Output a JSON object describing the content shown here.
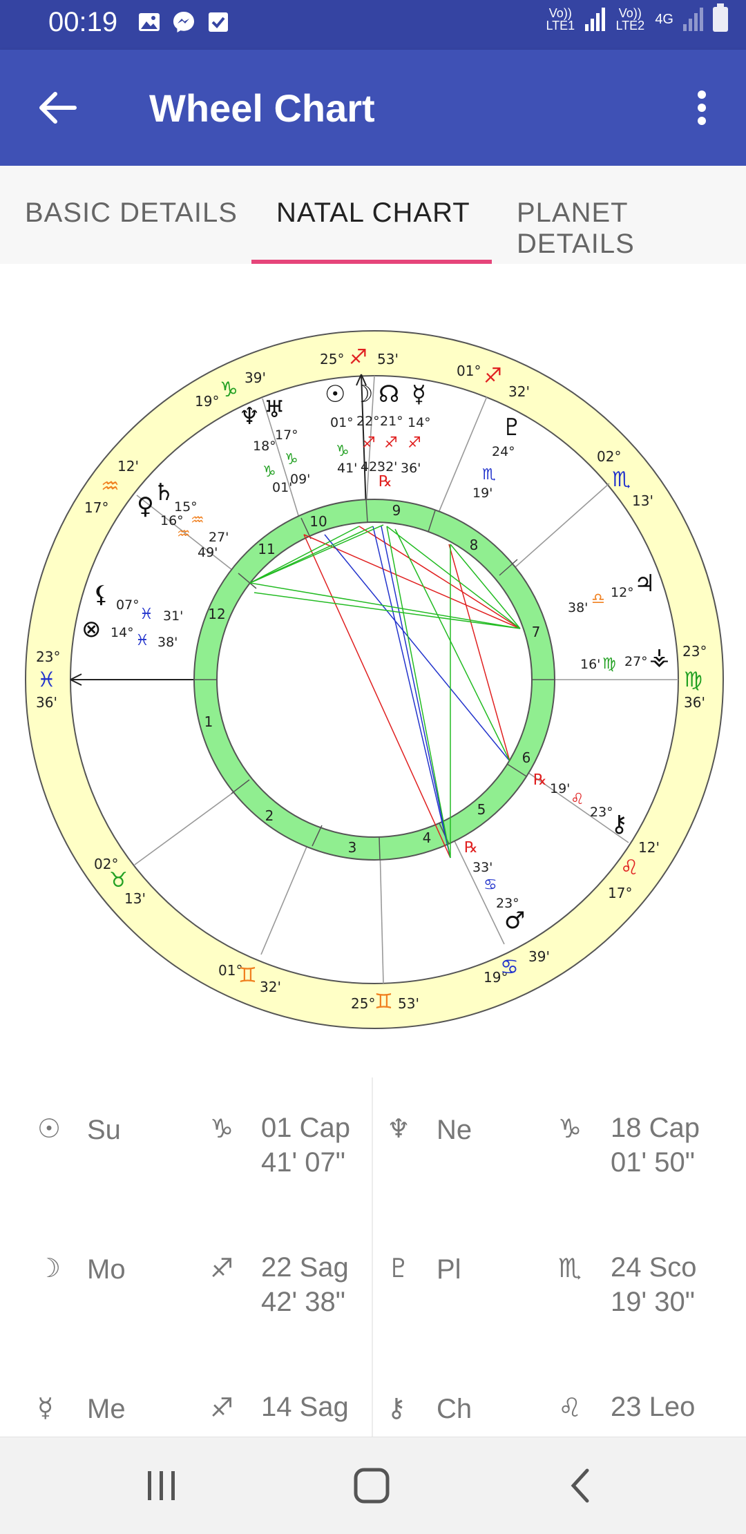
{
  "status_bar": {
    "time": "00:19",
    "network_1": "Vo)) LTE1",
    "network_2": "Vo)) LTE2",
    "network_3": "4G"
  },
  "app_bar": {
    "title": "Wheel Chart"
  },
  "tabs": [
    {
      "label": "BASIC DETAILS",
      "active": false
    },
    {
      "label": "NATAL CHART",
      "active": true
    },
    {
      "label": "PLANET DETAILS",
      "active": false
    }
  ],
  "wheel": {
    "cusp_labels": [
      {
        "deg": "25°",
        "min": "53'",
        "sign": "sagittarius"
      },
      {
        "deg": "01°",
        "min": "32'",
        "sign": "sagittarius"
      },
      {
        "deg": "02°",
        "min": "13'",
        "sign": "scorpio"
      },
      {
        "deg": "23°",
        "min": "36'",
        "sign": "virgo"
      },
      {
        "deg": "12'",
        "min": "17°",
        "sign": "leo"
      },
      {
        "deg": "39'",
        "min": "19°",
        "sign": "cancer"
      },
      {
        "deg": "25°",
        "min": "53'",
        "sign": "gemini"
      },
      {
        "deg": "01°",
        "min": "32'",
        "sign": "gemini"
      },
      {
        "deg": "02°",
        "min": "13'",
        "sign": "taurus"
      },
      {
        "deg": "23°",
        "min": "36'",
        "sign": "pisces"
      },
      {
        "deg": "12'",
        "min": "17°",
        "sign": "aquarius"
      },
      {
        "deg": "19°",
        "min": "39'",
        "sign": "capricorn"
      }
    ],
    "house_numbers": [
      "1",
      "2",
      "3",
      "4",
      "5",
      "6",
      "7",
      "8",
      "9",
      "10",
      "11",
      "12"
    ],
    "planet_labels": [
      {
        "text": "17°"
      },
      {
        "text": "18°"
      },
      {
        "text": "01'"
      },
      {
        "text": "09'"
      },
      {
        "text": "01°"
      },
      {
        "text": "22°"
      },
      {
        "text": "21°"
      },
      {
        "text": "14°"
      },
      {
        "text": "41'"
      },
      {
        "text": "42'"
      },
      {
        "text": "32'"
      },
      {
        "text": "36'"
      },
      {
        "text": "24°"
      },
      {
        "text": "19'"
      },
      {
        "text": "15°"
      },
      {
        "text": "16°"
      },
      {
        "text": "27'"
      },
      {
        "text": "49'"
      },
      {
        "text": "07°"
      },
      {
        "text": "31'"
      },
      {
        "text": "14°"
      },
      {
        "text": "38'"
      },
      {
        "text": "12°"
      },
      {
        "text": "38'"
      },
      {
        "text": "16'"
      },
      {
        "text": "27°"
      },
      {
        "text": "19'"
      },
      {
        "text": "23°"
      },
      {
        "text": "33'"
      },
      {
        "text": "23°"
      }
    ],
    "colors": {
      "ring_outer": "#ffffc6",
      "ring_inner": "#90ee90",
      "aspect_red": "#e02020",
      "aspect_green": "#22bb22",
      "aspect_blue": "#2233cc"
    }
  },
  "planets_table": [
    {
      "glyph": "sun-icon",
      "name": "Su",
      "sign": "capricorn-icon",
      "value": "01 Cap\n41' 07\""
    },
    {
      "glyph": "neptune-icon",
      "name": "Ne",
      "sign": "capricorn-icon",
      "value": "18 Cap\n01' 50\""
    },
    {
      "glyph": "moon-icon",
      "name": "Mo",
      "sign": "sagittarius-icon",
      "value": "22 Sag\n42' 38\""
    },
    {
      "glyph": "pluto-icon",
      "name": "Pl",
      "sign": "scorpio-icon",
      "value": "24 Sco\n19' 30\""
    },
    {
      "glyph": "mercury-icon",
      "name": "Me",
      "sign": "sagittarius-icon",
      "value": "14 Sag"
    },
    {
      "glyph": "chiron-icon",
      "name": "Ch",
      "sign": "leo-icon",
      "value": "23 Leo"
    }
  ]
}
